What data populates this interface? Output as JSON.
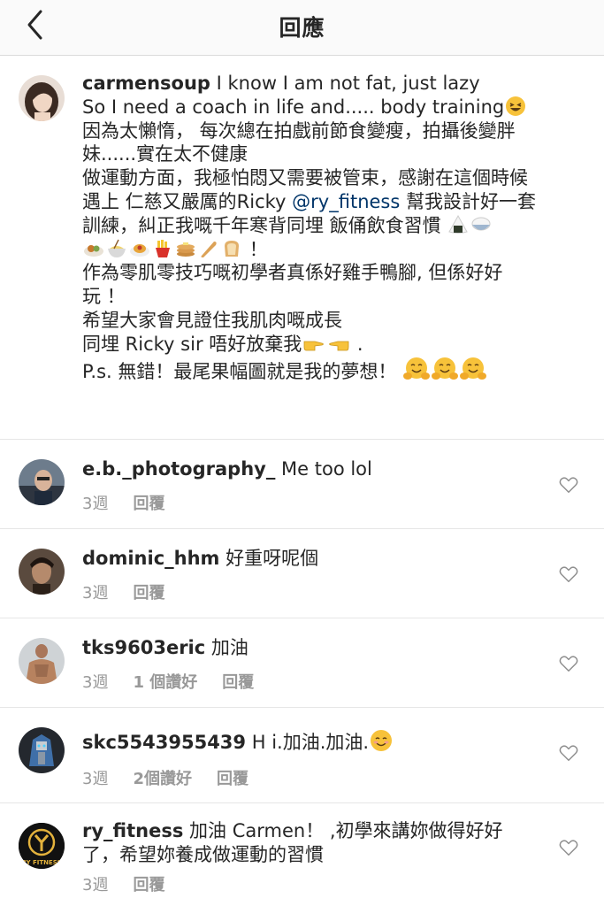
{
  "header": {
    "title": "回應",
    "back_icon": "chevron-left-icon"
  },
  "caption": {
    "username": "carmensoup",
    "line1_text": "I know I am not fat, just lazy",
    "line2_text": "So I need a coach in life and..... body training",
    "line3": "因為太懶惰， 每次總在拍戲前節食變瘦，拍攝後變胖",
    "line4": "妹......實在太不健康",
    "line5": "做運動方面，我極怕悶又需要被管束，感謝在這個時候",
    "line6_pre": "遇上  仁慈又嚴厲的Ricky ",
    "line6_mention": "@ry_fitness",
    "line6_post": " 幫我設計好一套",
    "line7": "訓練，糾正我嘅千年寒背同埋 飯俑飲食習慣",
    "line8_tail": "！",
    "line9": "作為零肌零技巧嘅初學者真係好雞手鴨腳, 但係好好",
    "line10": "玩 ！",
    "line11": "希望大家會見證住我肌肉嘅成長",
    "line12_pre": "同埋 Ricky sir 唔好放棄我",
    "line12_post": " .",
    "line13": "P.s. 無錯！最尾果幅圖就是我的夢想！"
  },
  "comments": [
    {
      "username": "e.b._photography_",
      "text": "Me too lol",
      "time": "3週",
      "likes": "",
      "reply": "回覆"
    },
    {
      "username": "dominic_hhm",
      "text": "好重呀呢個",
      "time": "3週",
      "likes": "",
      "reply": "回覆"
    },
    {
      "username": "tks9603eric",
      "text": "加油",
      "time": "3週",
      "likes": "1 個讚好",
      "reply": "回覆"
    },
    {
      "username": "skc5543955439",
      "text": "H i.加油.加油.",
      "time": "3週",
      "likes": "2個讚好",
      "reply": "回覆"
    },
    {
      "username": "ry_fitness",
      "text": "加油 Carmen！ ,初學來講妳做得好好",
      "text2": "了，希望妳養成做運動的習慣",
      "time": "3週",
      "likes": "",
      "reply": "回覆"
    }
  ],
  "avatar_logo_text": "RY FITNESS",
  "colors": {
    "text": "#262626",
    "meta": "#999999",
    "mention": "#003569",
    "divider": "#e6e6e6",
    "header_bg": "#fafafa"
  },
  "icons": {
    "like": "heart-outline-icon",
    "emoji": [
      "grinning-squint-emoji",
      "rice-ball-emoji",
      "cooked-rice-emoji",
      "food-plate-emoji",
      "noodle-bowl-emoji",
      "spaghetti-emoji",
      "french-fries-emoji",
      "pancakes-emoji",
      "baguette-emoji",
      "bread-emoji",
      "pointing-right-emoji",
      "pointing-left-emoji",
      "hugging-face-emoji",
      "smiling-face-emoji"
    ]
  }
}
